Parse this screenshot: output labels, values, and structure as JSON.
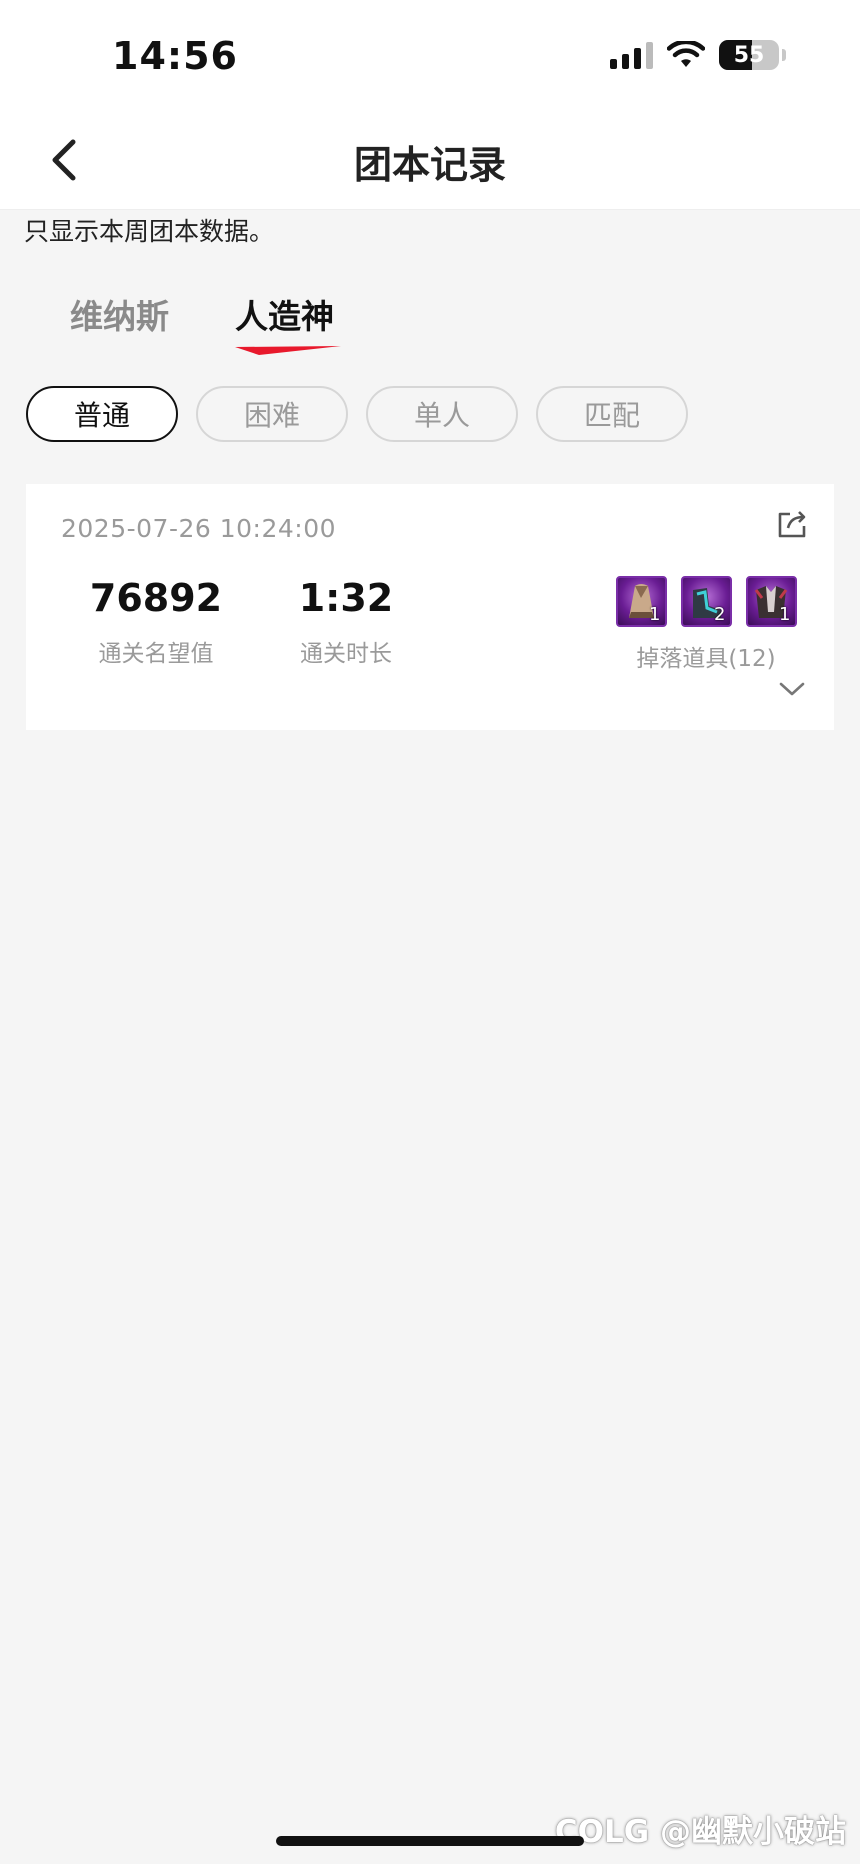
{
  "status_bar": {
    "time": "14:56",
    "battery": "55"
  },
  "nav": {
    "title": "团本记录"
  },
  "notice": "只显示本周团本数据。",
  "raid_tabs": [
    {
      "label": "维纳斯",
      "active": false
    },
    {
      "label": "人造神",
      "active": true
    }
  ],
  "filters": [
    {
      "label": "普通",
      "active": true
    },
    {
      "label": "困难",
      "active": false
    },
    {
      "label": "单人",
      "active": false
    },
    {
      "label": "匹配",
      "active": false
    }
  ],
  "record": {
    "datetime": "2025-07-26 10:24:00",
    "reputation_value": "76892",
    "reputation_label": "通关名望值",
    "duration_value": "1:32",
    "duration_label": "通关时长",
    "drops": [
      {
        "count": "1",
        "icon": "robe-item-icon"
      },
      {
        "count": "2",
        "icon": "boots-item-icon"
      },
      {
        "count": "1",
        "icon": "armor-item-icon"
      }
    ],
    "drops_label": "掉落道具(12)"
  },
  "watermark": "COLG @幽默小破站",
  "colors": {
    "accent": "#e8192c",
    "tab_inactive": "#8a8a8a",
    "drop_frame": "#7a2ea8"
  }
}
